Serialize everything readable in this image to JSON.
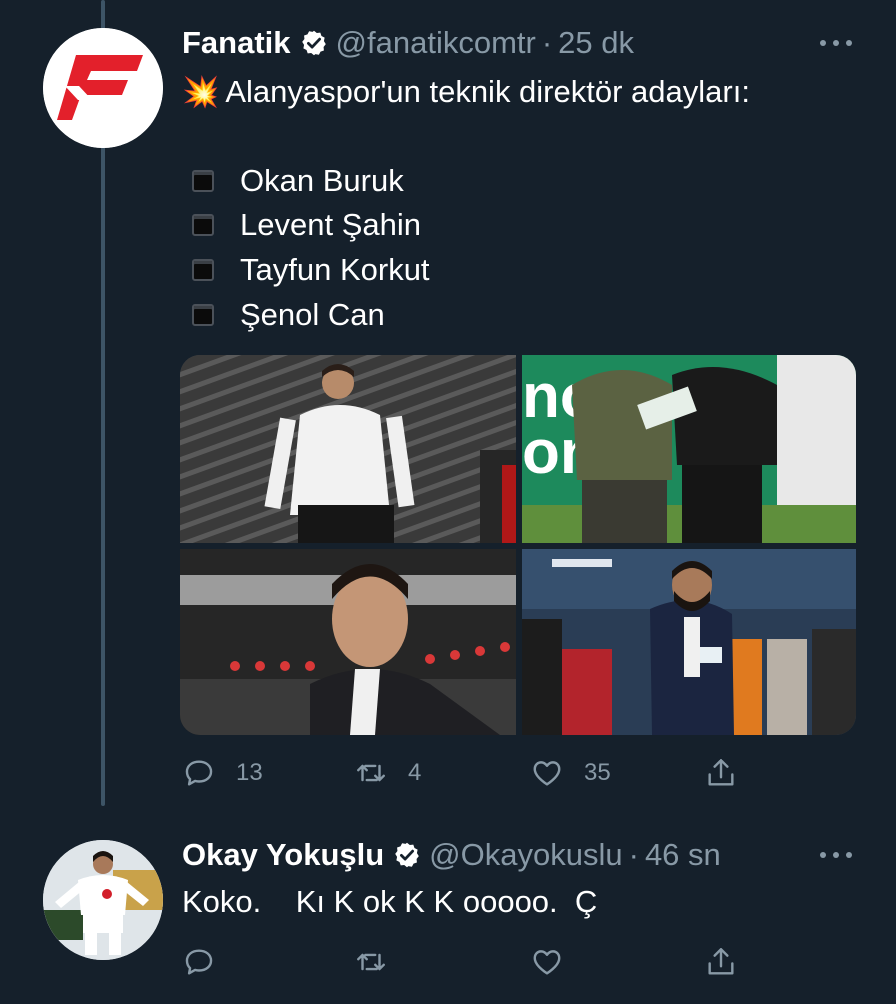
{
  "tweets": [
    {
      "name": "Fanatik",
      "handle": "@fanatikcomtr",
      "separator": "·",
      "time": "25 dk",
      "emoji": "💥",
      "headline": "Alanyaspor'un teknik direktör adayları:",
      "list": [
        "Okan Buruk",
        "Levent Şahin",
        "Tayfun Korkut",
        "Şenol Can"
      ],
      "stats": {
        "replies": "13",
        "retweets": "4",
        "likes": "35"
      },
      "icons": [
        "verified-badge-icon",
        "more-icon",
        "reply-icon",
        "retweet-icon",
        "like-icon",
        "share-icon"
      ]
    },
    {
      "name": "Okay Yokuşlu",
      "handle": "@Okayokuslu",
      "separator": "·",
      "time": "46 sn",
      "text": "Koko.    Kı K ok K K ooooo.  Ç",
      "icons": [
        "verified-badge-icon",
        "more-icon",
        "reply-icon",
        "retweet-icon",
        "like-icon",
        "share-icon"
      ]
    }
  ],
  "colors": {
    "background": "#15202b",
    "muted": "#8899a6",
    "brand_red": "#e3202b",
    "thread_line": "#3d5466"
  }
}
